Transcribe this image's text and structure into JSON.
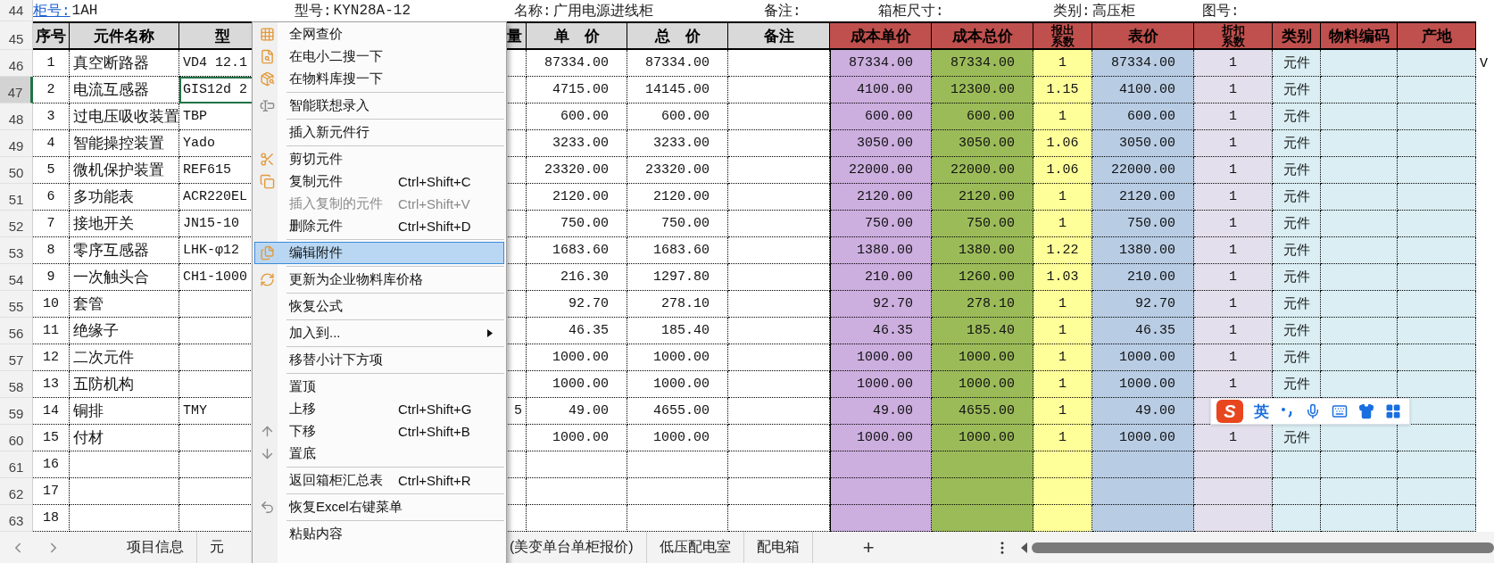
{
  "info_row": {
    "row_number": "44",
    "fields": [
      {
        "label": "柜号:",
        "value": "1AH",
        "kind": "link"
      },
      {
        "label": "型号:",
        "value": "KYN28A-12",
        "kind": "plain"
      },
      {
        "label": "名称:",
        "value": "广用电源进线柜",
        "kind": "plain"
      },
      {
        "label": "备注:",
        "kind": "plain"
      },
      {
        "label": "箱柜尺寸:",
        "kind": "plain"
      },
      {
        "label": "类别:",
        "value": "高压柜",
        "kind": "plain"
      },
      {
        "label": "图号:",
        "kind": "plain"
      }
    ]
  },
  "header_row_number": "45",
  "columns": [
    {
      "header": {
        "label": "序号",
        "color": "#d9d9d9"
      },
      "kind": "index",
      "color": "#ffffff"
    },
    {
      "header": {
        "label": "元件名称",
        "color": "#d9d9d9"
      },
      "kind": "text",
      "color": "#ffffff"
    },
    {
      "header": {
        "label": "型",
        "color": "#d9d9d9"
      },
      "kind": "code",
      "color": "#ffffff"
    },
    {
      "header": {
        "label": "量",
        "color": "#d9d9d9"
      },
      "kind": "qty",
      "color": "#ffffff"
    },
    {
      "header": {
        "label": "单　价",
        "color": "#d9d9d9"
      },
      "kind": "number",
      "color": "#ffffff"
    },
    {
      "header": {
        "label": "总　价",
        "color": "#d9d9d9"
      },
      "kind": "number",
      "color": "#ffffff"
    },
    {
      "header": {
        "label": "备注",
        "color": "#d9d9d9"
      },
      "kind": "text",
      "color": "#ffffff"
    },
    {
      "header": {
        "label": "成本单价",
        "color": "#c0504d"
      },
      "kind": "number",
      "color": "#ccaedf"
    },
    {
      "header": {
        "label": "成本总价",
        "color": "#c0504d"
      },
      "kind": "number",
      "color": "#9bbb59"
    },
    {
      "header": {
        "label": "报出系数",
        "color": "#c0504d"
      },
      "kind": "factor",
      "color": "#ffff99"
    },
    {
      "header": {
        "label": "表价",
        "color": "#c0504d"
      },
      "kind": "number",
      "color": "#b8cce4"
    },
    {
      "header": {
        "label": "折扣系数",
        "color": "#c0504d"
      },
      "kind": "factor",
      "color": "#e4dfec"
    },
    {
      "header": {
        "label": "类别",
        "color": "#c0504d"
      },
      "kind": "factor",
      "color": "#daeef3"
    },
    {
      "header": {
        "label": "物料编码",
        "color": "#c0504d"
      },
      "kind": "text",
      "color": "#daeef3"
    },
    {
      "header": {
        "label": "产地",
        "color": "#c0504d"
      },
      "kind": "text",
      "color": "#daeef3"
    }
  ],
  "rows": [
    {
      "row_number": "46",
      "selected": false,
      "cells": [
        "1",
        "真空断路器",
        "VD4 12.1",
        null,
        "87334.00",
        "87334.00",
        null,
        "87334.00",
        "87334.00",
        "1",
        "87334.00",
        "1",
        "元件",
        null,
        null
      ],
      "spill": "V"
    },
    {
      "row_number": "47",
      "selected": true,
      "cells": [
        "2",
        "电流互感器",
        "GIS12d 2",
        null,
        "4715.00",
        "14145.00",
        null,
        "4100.00",
        "12300.00",
        "1.15",
        "4100.00",
        "1",
        "元件",
        null,
        null
      ]
    },
    {
      "row_number": "48",
      "selected": false,
      "cells": [
        "3",
        "过电压吸收装置",
        "TBP",
        null,
        "600.00",
        "600.00",
        null,
        "600.00",
        "600.00",
        "1",
        "600.00",
        "1",
        "元件",
        null,
        null
      ]
    },
    {
      "row_number": "49",
      "selected": false,
      "cells": [
        "4",
        "智能操控装置",
        "Yado",
        null,
        "3233.00",
        "3233.00",
        null,
        "3050.00",
        "3050.00",
        "1.06",
        "3050.00",
        "1",
        "元件",
        null,
        null
      ]
    },
    {
      "row_number": "50",
      "selected": false,
      "cells": [
        "5",
        "微机保护装置",
        "REF615",
        null,
        "23320.00",
        "23320.00",
        null,
        "22000.00",
        "22000.00",
        "1.06",
        "22000.00",
        "1",
        "元件",
        null,
        null
      ]
    },
    {
      "row_number": "51",
      "selected": false,
      "cells": [
        "6",
        "多功能表",
        "ACR220EL",
        null,
        "2120.00",
        "2120.00",
        null,
        "2120.00",
        "2120.00",
        "1",
        "2120.00",
        "1",
        "元件",
        null,
        null
      ]
    },
    {
      "row_number": "52",
      "selected": false,
      "cells": [
        "7",
        "接地开关",
        "JN15-10",
        null,
        "750.00",
        "750.00",
        null,
        "750.00",
        "750.00",
        "1",
        "750.00",
        "1",
        "元件",
        null,
        null
      ]
    },
    {
      "row_number": "53",
      "selected": false,
      "cells": [
        "8",
        "零序互感器",
        "LHK-φ12",
        null,
        "1683.60",
        "1683.60",
        null,
        "1380.00",
        "1380.00",
        "1.22",
        "1380.00",
        "1",
        "元件",
        null,
        null
      ]
    },
    {
      "row_number": "54",
      "selected": false,
      "cells": [
        "9",
        "一次触头合",
        "CH1-1000",
        null,
        "216.30",
        "1297.80",
        null,
        "210.00",
        "1260.00",
        "1.03",
        "210.00",
        "1",
        "元件",
        null,
        null
      ]
    },
    {
      "row_number": "55",
      "selected": false,
      "cells": [
        "10",
        "套管",
        null,
        null,
        "92.70",
        "278.10",
        null,
        "92.70",
        "278.10",
        "1",
        "92.70",
        "1",
        "元件",
        null,
        null
      ]
    },
    {
      "row_number": "56",
      "selected": false,
      "cells": [
        "11",
        "绝缘子",
        null,
        null,
        "46.35",
        "185.40",
        null,
        "46.35",
        "185.40",
        "1",
        "46.35",
        "1",
        "元件",
        null,
        null
      ]
    },
    {
      "row_number": "57",
      "selected": false,
      "cells": [
        "12",
        "二次元件",
        null,
        null,
        "1000.00",
        "1000.00",
        null,
        "1000.00",
        "1000.00",
        "1",
        "1000.00",
        "1",
        "元件",
        null,
        null
      ]
    },
    {
      "row_number": "58",
      "selected": false,
      "cells": [
        "13",
        "五防机构",
        null,
        null,
        "1000.00",
        "1000.00",
        null,
        "1000.00",
        "1000.00",
        "1",
        "1000.00",
        "1",
        "元件",
        null,
        null
      ]
    },
    {
      "row_number": "59",
      "selected": false,
      "cells": [
        "14",
        "铜排",
        "TMY",
        "5",
        "49.00",
        "4655.00",
        null,
        "49.00",
        "4655.00",
        "1",
        "49.00",
        null,
        null,
        null,
        null
      ]
    },
    {
      "row_number": "60",
      "selected": false,
      "cells": [
        "15",
        "付材",
        null,
        null,
        "1000.00",
        "1000.00",
        null,
        "1000.00",
        "1000.00",
        "1",
        "1000.00",
        "1",
        "元件",
        null,
        null
      ]
    },
    {
      "row_number": "61",
      "selected": false,
      "cells": [
        "16",
        null,
        null,
        null,
        null,
        null,
        null,
        null,
        null,
        null,
        null,
        null,
        null,
        null,
        null
      ]
    },
    {
      "row_number": "62",
      "selected": false,
      "cells": [
        "17",
        null,
        null,
        null,
        null,
        null,
        null,
        null,
        null,
        null,
        null,
        null,
        null,
        null,
        null
      ]
    },
    {
      "row_number": "63",
      "selected": false,
      "cells": [
        "18",
        null,
        null,
        null,
        null,
        null,
        null,
        null,
        null,
        null,
        null,
        null,
        null,
        null,
        null
      ]
    }
  ],
  "context_menu": {
    "items": [
      {
        "kind": "item",
        "label": "全网查价",
        "disabled": false,
        "selected": false,
        "submenu": false
      },
      {
        "kind": "item",
        "label": "在电小二搜一下",
        "disabled": false,
        "selected": false,
        "submenu": false
      },
      {
        "kind": "item",
        "label": "在物料库搜一下",
        "disabled": false,
        "selected": false,
        "submenu": false
      },
      {
        "kind": "separator"
      },
      {
        "kind": "item",
        "label": "智能联想录入",
        "disabled": false,
        "selected": false,
        "submenu": false
      },
      {
        "kind": "separator"
      },
      {
        "kind": "item",
        "label": "插入新元件行",
        "disabled": false,
        "selected": false,
        "submenu": false
      },
      {
        "kind": "separator"
      },
      {
        "kind": "item",
        "label": "剪切元件",
        "disabled": false,
        "selected": false,
        "submenu": false
      },
      {
        "kind": "item",
        "label": "复制元件",
        "shortcut": "Ctrl+Shift+C",
        "disabled": false,
        "selected": false,
        "submenu": false
      },
      {
        "kind": "item",
        "label": "插入复制的元件",
        "shortcut": "Ctrl+Shift+V",
        "disabled": true,
        "selected": false,
        "submenu": false
      },
      {
        "kind": "item",
        "label": "删除元件",
        "shortcut": "Ctrl+Shift+D",
        "disabled": false,
        "selected": false,
        "submenu": false
      },
      {
        "kind": "separator"
      },
      {
        "kind": "item",
        "label": "编辑附件",
        "disabled": false,
        "selected": true,
        "submenu": false
      },
      {
        "kind": "separator"
      },
      {
        "kind": "item",
        "label": "更新为企业物料库价格",
        "disabled": false,
        "selected": false,
        "submenu": false
      },
      {
        "kind": "separator"
      },
      {
        "kind": "item",
        "label": "恢复公式",
        "disabled": false,
        "selected": false,
        "submenu": false
      },
      {
        "kind": "separator"
      },
      {
        "kind": "item",
        "label": "加入到...",
        "disabled": false,
        "selected": false,
        "submenu": true
      },
      {
        "kind": "separator"
      },
      {
        "kind": "item",
        "label": "移替小计下方项",
        "disabled": false,
        "selected": false,
        "submenu": false
      },
      {
        "kind": "separator"
      },
      {
        "kind": "item",
        "label": "置顶",
        "disabled": false,
        "selected": false,
        "submenu": false
      },
      {
        "kind": "item",
        "label": "上移",
        "shortcut": "Ctrl+Shift+G",
        "disabled": false,
        "selected": false,
        "submenu": false
      },
      {
        "kind": "item",
        "label": "下移",
        "shortcut": "Ctrl+Shift+B",
        "disabled": false,
        "selected": false,
        "submenu": false
      },
      {
        "kind": "item",
        "label": "置底",
        "disabled": false,
        "selected": false,
        "submenu": false
      },
      {
        "kind": "separator"
      },
      {
        "kind": "item",
        "label": "返回箱柜汇总表",
        "shortcut": "Ctrl+Shift+R",
        "disabled": false,
        "selected": false,
        "submenu": false
      },
      {
        "kind": "separator"
      },
      {
        "kind": "item",
        "label": "恢复Excel右键菜单",
        "disabled": false,
        "selected": false,
        "submenu": false
      },
      {
        "kind": "separator"
      },
      {
        "kind": "item",
        "label": "粘贴内容",
        "disabled": false,
        "selected": false,
        "submenu": false
      }
    ]
  },
  "sheet_tabs": [
    {
      "label": "项目信息"
    },
    {
      "label": "元"
    },
    {
      "label": "(美变单台单柜报价)"
    },
    {
      "label": "低压配电室"
    },
    {
      "label": "配电箱"
    }
  ],
  "add_sheet": "+",
  "ime_toolbar": {
    "logo": "S",
    "mode": "英"
  }
}
